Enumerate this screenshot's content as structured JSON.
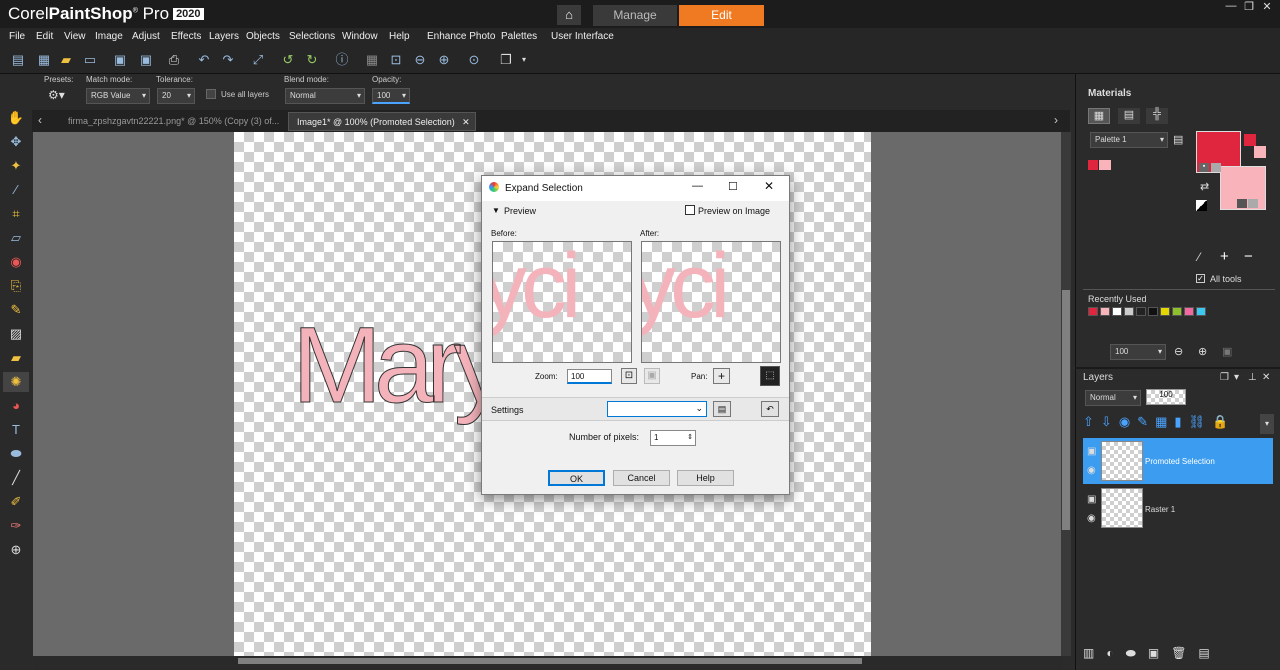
{
  "app": {
    "brand": "Corel",
    "product": "PaintShop",
    "product2": "Pro",
    "year": "2020"
  },
  "workspace_tabs": {
    "manage": "Manage",
    "edit": "Edit"
  },
  "menu": [
    "File",
    "Edit",
    "View",
    "Image",
    "Adjust",
    "Effects",
    "Layers",
    "Objects",
    "Selections",
    "Window",
    "Help",
    "Enhance Photo",
    "Palettes",
    "User Interface"
  ],
  "options": {
    "presets_label": "Presets:",
    "match_mode_label": "Match mode:",
    "match_mode_value": "RGB Value",
    "tolerance_label": "Tolerance:",
    "tolerance_value": "20",
    "use_all_layers": "Use all layers",
    "blend_mode_label": "Blend mode:",
    "blend_mode_value": "Normal",
    "opacity_label": "Opacity:",
    "opacity_value": "100"
  },
  "doc_tabs": [
    "firma_zpshzgavtn22221.png* @ 150% (Copy (3) of...",
    "Image1* @ 100% (Promoted Selection)"
  ],
  "canvas_text": "Mary",
  "dialog": {
    "title": "Expand Selection",
    "preview_label": "Preview",
    "preview_on_image": "Preview on Image",
    "before_label": "Before:",
    "after_label": "After:",
    "preview_glyphs": "yci",
    "zoom_label": "Zoom:",
    "zoom_value": "100",
    "pan_label": "Pan:",
    "settings_label": "Settings",
    "pixels_label": "Number of pixels:",
    "pixels_value": "1",
    "ok": "OK",
    "cancel": "Cancel",
    "help": "Help"
  },
  "materials": {
    "title": "Materials",
    "palette_value": "Palette 1",
    "all_tools": "All tools",
    "recently_used": "Recently Used",
    "foreground_color": "#e0253f",
    "background_color": "#f8b3bb",
    "recent_colors": [
      "#e0253f",
      "#f8b3bb",
      "#ffffff",
      "#cccccc",
      "#222222",
      "#111111",
      "#e6d600",
      "#8fbf2a",
      "#f06aa0",
      "#3cc8f0"
    ],
    "zoom_value": "100"
  },
  "layers": {
    "title": "Layers",
    "blend_value": "Normal",
    "opacity_value": "100",
    "items": [
      {
        "name": "Promoted Selection",
        "selected": true
      },
      {
        "name": "Raster 1",
        "selected": false
      }
    ]
  }
}
